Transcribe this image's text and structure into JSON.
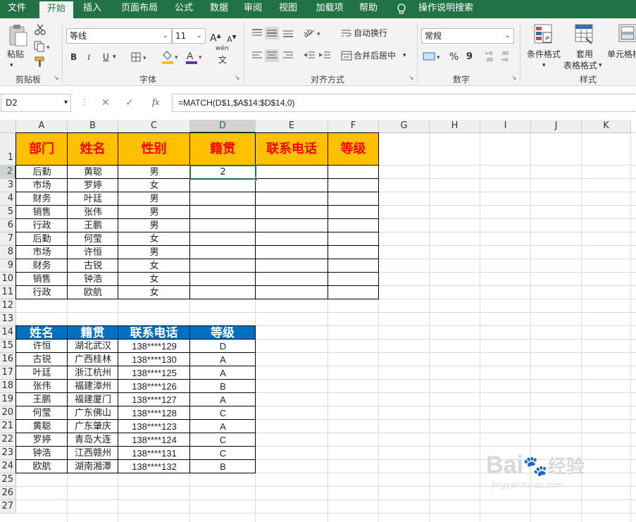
{
  "menu": {
    "tabs": [
      "文件",
      "开始",
      "插入",
      "页面布局",
      "公式",
      "数据",
      "审阅",
      "视图",
      "加载项",
      "帮助"
    ],
    "active": "开始",
    "search_label": "操作说明搜索"
  },
  "ribbon": {
    "clipboard": {
      "paste": "粘贴",
      "group": "剪贴板"
    },
    "font": {
      "name": "等线",
      "size": "11",
      "bold": "B",
      "italic": "I",
      "underline": "U",
      "grow": "A",
      "shrink": "A",
      "fontcolor": "A",
      "phonetic_top": "wén",
      "phonetic_bottom": "文",
      "group": "字体"
    },
    "alignment": {
      "wrap": "自动换行",
      "merge": "合并后居中",
      "group": "对齐方式"
    },
    "number": {
      "format": "常规",
      "percent": "%",
      "comma": "9",
      "group": "数字"
    },
    "styles": {
      "conditional": "条件格式",
      "table_top": "套用",
      "table_bottom": "表格格式",
      "cell_styles": "单元格样",
      "group": "样式"
    }
  },
  "formula_bar": {
    "name_box": "D2",
    "formula": "=MATCH(D$1,$A$14:$D$14,0)",
    "fx": "fx"
  },
  "sheet": {
    "columns": [
      "A",
      "B",
      "C",
      "D",
      "E",
      "F",
      "G",
      "H",
      "I",
      "J",
      "K"
    ],
    "rows": [
      "1",
      "2",
      "3",
      "4",
      "5",
      "6",
      "7",
      "8",
      "9",
      "10",
      "11",
      "12",
      "13",
      "14",
      "15",
      "16",
      "17",
      "18",
      "19",
      "20",
      "21",
      "22",
      "23",
      "24",
      "25",
      "26",
      "27"
    ],
    "table1_headers": [
      "部门",
      "姓名",
      "性别",
      "籍贯",
      "联系电话",
      "等级"
    ],
    "table1_rows": [
      [
        "后勤",
        "黄聪",
        "男",
        "2"
      ],
      [
        "市场",
        "罗婷",
        "女",
        ""
      ],
      [
        "财务",
        "叶廷",
        "男",
        ""
      ],
      [
        "销售",
        "张伟",
        "男",
        ""
      ],
      [
        "行政",
        "王鹏",
        "男",
        ""
      ],
      [
        "后勤",
        "何莹",
        "女",
        ""
      ],
      [
        "市场",
        "许恒",
        "男",
        ""
      ],
      [
        "财务",
        "古锐",
        "女",
        ""
      ],
      [
        "销售",
        "钟浩",
        "女",
        ""
      ],
      [
        "行政",
        "欧航",
        "女",
        ""
      ]
    ],
    "table2_headers": [
      "姓名",
      "籍贯",
      "联系电话",
      "等级"
    ],
    "table2_rows": [
      [
        "许恒",
        "湖北武汉",
        "138****129",
        "D"
      ],
      [
        "古锐",
        "广西桂林",
        "138****130",
        "A"
      ],
      [
        "叶廷",
        "浙江杭州",
        "138****125",
        "A"
      ],
      [
        "张伟",
        "福建漳州",
        "138****126",
        "B"
      ],
      [
        "王鹏",
        "福建厦门",
        "138****127",
        "A"
      ],
      [
        "何莹",
        "广东佛山",
        "138****128",
        "C"
      ],
      [
        "黄聪",
        "广东肇庆",
        "138****123",
        "A"
      ],
      [
        "罗婷",
        "青岛大连",
        "138****124",
        "C"
      ],
      [
        "钟浩",
        "江西赣州",
        "138****131",
        "C"
      ],
      [
        "欧航",
        "湖南湘潭",
        "138****132",
        "B"
      ]
    ]
  },
  "watermark": {
    "logo": "Bai",
    "brand": "经验",
    "url": "jingyan.baidu.com"
  },
  "colors": {
    "excel_green": "#217346",
    "header_fill": "#ffc000",
    "header_text": "#ff0000",
    "blue_fill": "#0070c0"
  }
}
